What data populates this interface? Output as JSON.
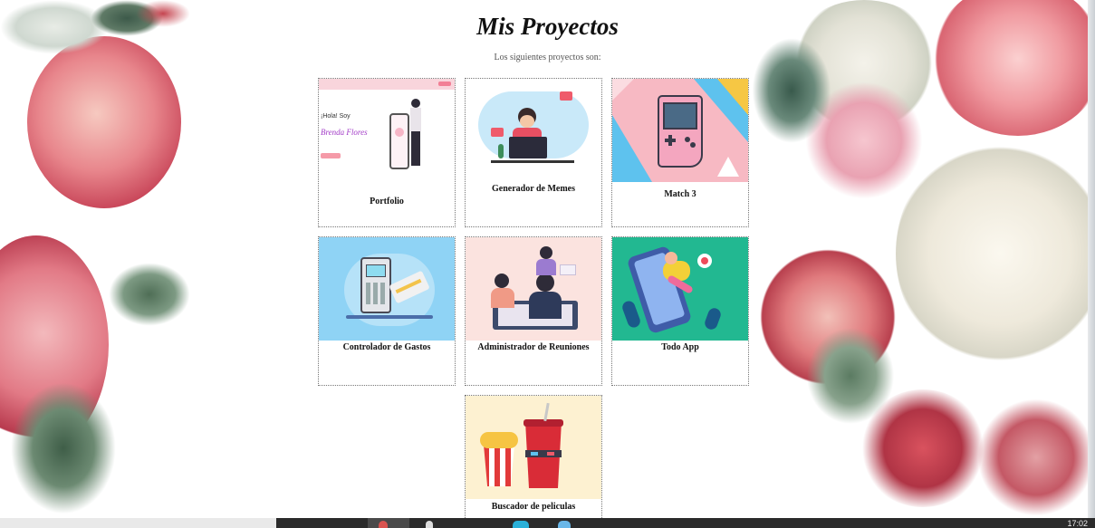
{
  "page": {
    "title": "Mis Proyectos",
    "subtitle": "Los siguientes proyectos son:"
  },
  "projects": [
    {
      "label": "Portfolio",
      "thumb_text_1": "¡Hola! Soy",
      "thumb_text_2": "Brenda Flores"
    },
    {
      "label": "Generador de Memes"
    },
    {
      "label": "Match 3"
    },
    {
      "label": "Controlador de Gastos"
    },
    {
      "label": "Administrador de Reuniones"
    },
    {
      "label": "Todo App"
    },
    {
      "label": "Buscador de peliculas"
    }
  ],
  "taskbar": {
    "clock": "17:02"
  },
  "colors": {
    "accent_pink": "#f7b9c3",
    "sky_blue": "#6ec6f0",
    "teal": "#1fb98d",
    "cream": "#fdf1d1"
  }
}
